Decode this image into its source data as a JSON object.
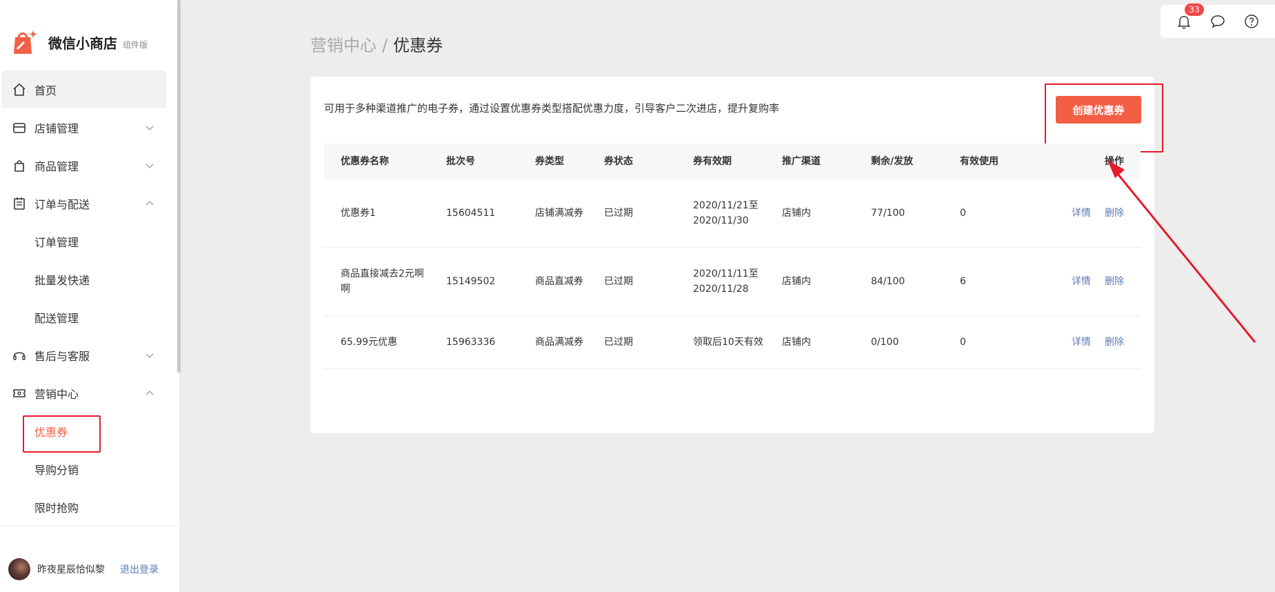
{
  "brand": {
    "name": "微信小商店",
    "tag": "组件版"
  },
  "nav": {
    "home": "首页",
    "store": "店铺管理",
    "product": "商品管理",
    "orders": "订单与配送",
    "orders_sub": [
      "订单管理",
      "批量发快递",
      "配送管理"
    ],
    "service": "售后与客服",
    "marketing": "营销中心",
    "marketing_sub": [
      "优惠券",
      "导购分销",
      "限时抢购"
    ]
  },
  "user": {
    "name": "昨夜星辰恰似黎",
    "logout": "退出登录"
  },
  "toolbar": {
    "notification_count": "33"
  },
  "breadcrumb": {
    "parent": "营销中心",
    "separator": "/",
    "current": "优惠券"
  },
  "card": {
    "description": "可用于多种渠道推广的电子券，通过设置优惠券类型搭配优惠力度，引导客户二次进店，提升复购率",
    "create_button": "创建优惠券"
  },
  "table": {
    "headers": [
      "优惠券名称",
      "批次号",
      "券类型",
      "券状态",
      "券有效期",
      "推广渠道",
      "剩余/发放",
      "有效使用",
      "操作"
    ],
    "rows": [
      {
        "name": "优惠券1",
        "batch": "15604511",
        "type": "店铺满减券",
        "status": "已过期",
        "validity": "2020/11/21至2020/11/30",
        "channel": "店铺内",
        "remaining": "77/100",
        "used": "0",
        "detail": "详情",
        "delete": "删除"
      },
      {
        "name": "商品直接减去2元啊啊",
        "batch": "15149502",
        "type": "商品直减券",
        "status": "已过期",
        "validity": "2020/11/11至2020/11/28",
        "channel": "店铺内",
        "remaining": "84/100",
        "used": "6",
        "detail": "详情",
        "delete": "删除"
      },
      {
        "name": "65.99元优惠",
        "batch": "15963336",
        "type": "商品满减券",
        "status": "已过期",
        "validity": "领取后10天有效",
        "channel": "店铺内",
        "remaining": "0/100",
        "used": "0",
        "detail": "详情",
        "delete": "删除"
      }
    ]
  },
  "colors": {
    "accent": "#f35f45",
    "link": "#5b7bb4",
    "annotation": "#e8192c"
  }
}
